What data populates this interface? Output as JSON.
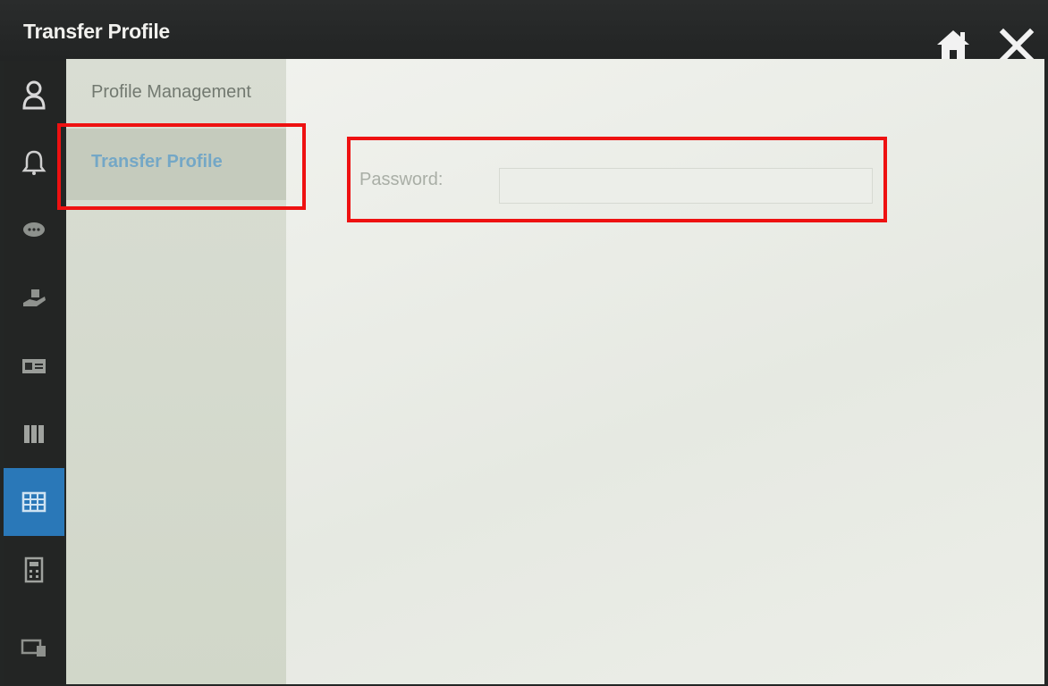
{
  "window": {
    "title": "Transfer Profile"
  },
  "header_icons": [
    "home-icon",
    "close-icon"
  ],
  "sidebar": {
    "icons": [
      {
        "name": "person-icon",
        "active": false
      },
      {
        "name": "bell-icon",
        "active": false
      },
      {
        "name": "chat-icon",
        "active": false
      },
      {
        "name": "hand-icon",
        "active": false
      },
      {
        "name": "card-icon",
        "active": false
      },
      {
        "name": "columns-icon",
        "active": false
      },
      {
        "name": "grid-icon",
        "active": true
      },
      {
        "name": "calculator-icon",
        "active": false
      },
      {
        "name": "display-icon",
        "active": false
      }
    ],
    "active_color": "#2a78b8"
  },
  "subnav": {
    "items": [
      {
        "label": "Profile Management"
      },
      {
        "label": "Transfer Profile",
        "selected": true
      }
    ]
  },
  "form": {
    "password_label": "Password:",
    "password_value": ""
  },
  "annotations": {
    "highlight_color": "#ee1111"
  }
}
